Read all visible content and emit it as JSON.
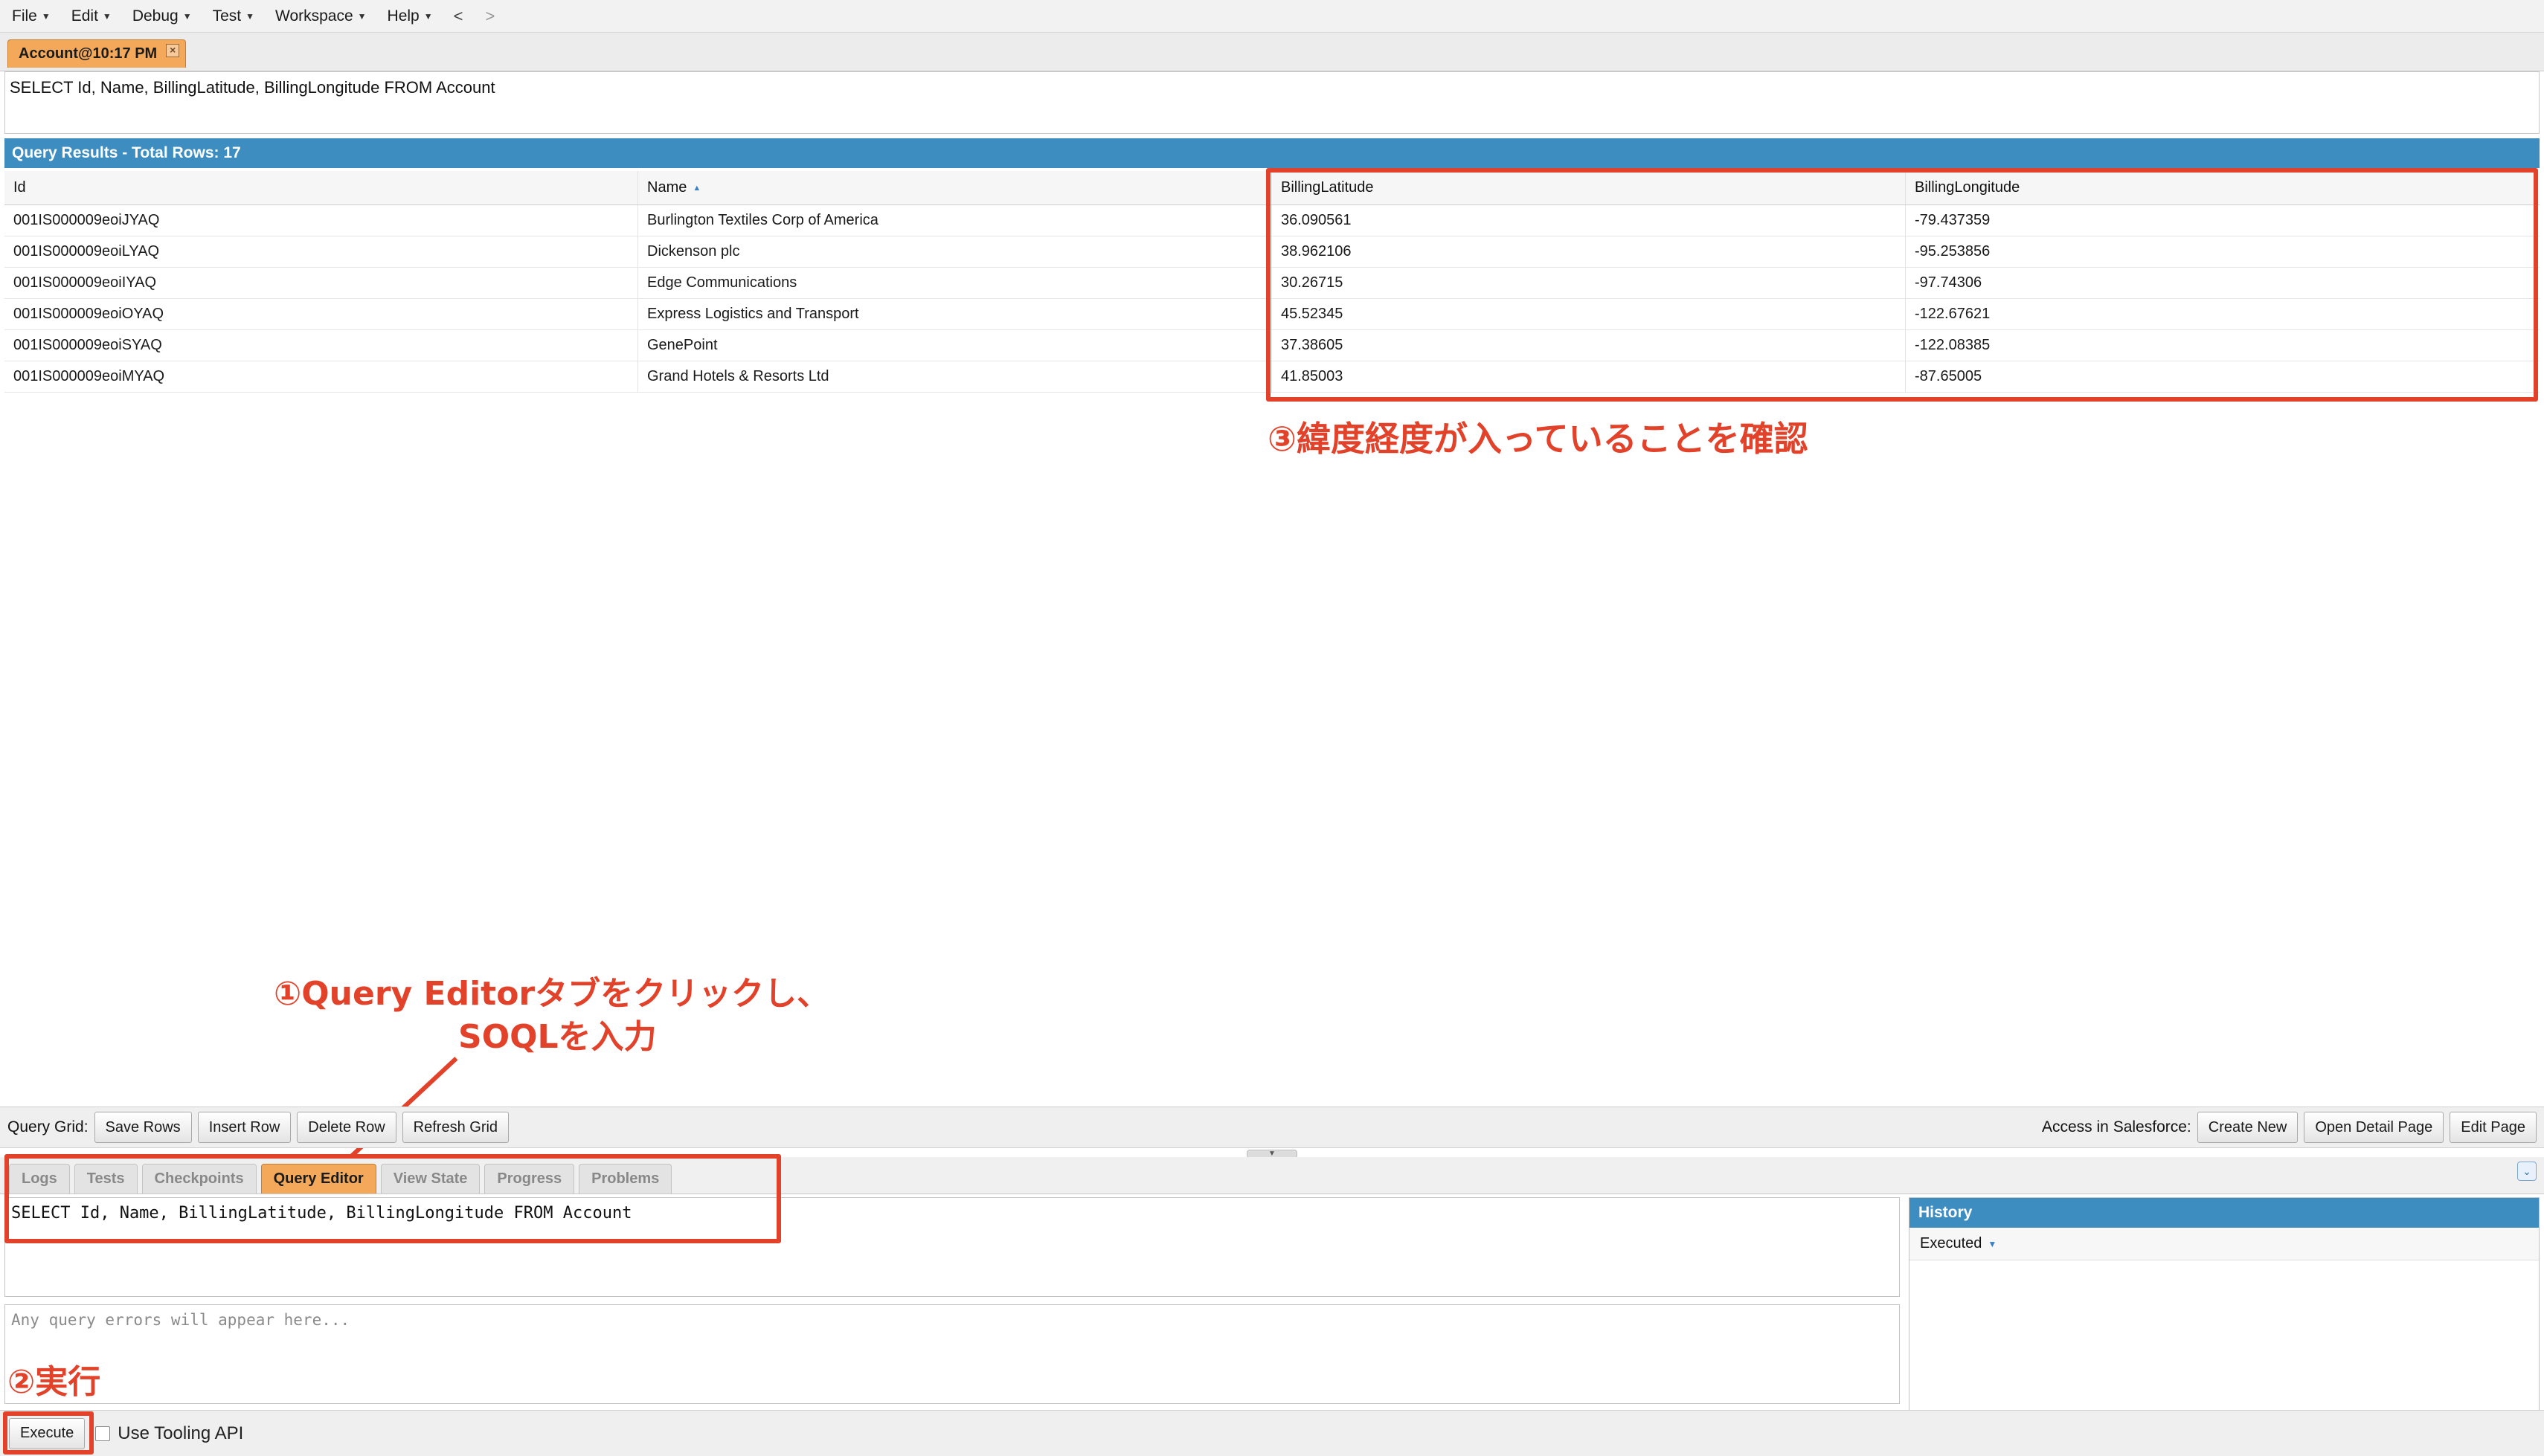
{
  "menu": {
    "items": [
      "File",
      "Edit",
      "Debug",
      "Test",
      "Workspace",
      "Help"
    ],
    "back": "<",
    "forward": ">"
  },
  "file_tab": {
    "label": "Account@10:17 PM",
    "close": "×"
  },
  "query_display": "SELECT Id, Name, BillingLatitude, BillingLongitude FROM Account",
  "results": {
    "header": "Query Results - Total Rows: 17",
    "columns": [
      "Id",
      "Name",
      "BillingLatitude",
      "BillingLongitude"
    ],
    "sorted_column": "Name",
    "rows": [
      [
        "001IS000009eoiJYAQ",
        "Burlington Textiles Corp of America",
        "36.090561",
        "-79.437359"
      ],
      [
        "001IS000009eoiLYAQ",
        "Dickenson plc",
        "38.962106",
        "-95.253856"
      ],
      [
        "001IS000009eoiIYAQ",
        "Edge Communications",
        "30.26715",
        "-97.74306"
      ],
      [
        "001IS000009eoiOYAQ",
        "Express Logistics and Transport",
        "45.52345",
        "-122.67621"
      ],
      [
        "001IS000009eoiSYAQ",
        "GenePoint",
        "37.38605",
        "-122.08385"
      ],
      [
        "001IS000009eoiMYAQ",
        "Grand Hotels & Resorts Ltd",
        "41.85003",
        "-87.65005"
      ]
    ]
  },
  "annotations": {
    "step3": "③緯度経度が入っていることを確認",
    "step1_line1": "①Query Editorタブをクリックし、",
    "step1_line2": "SOQLを入力",
    "step2": "②実行",
    "color": "#e2412a"
  },
  "grid_toolbar": {
    "label": "Query Grid:",
    "buttons": [
      "Save Rows",
      "Insert Row",
      "Delete Row",
      "Refresh Grid"
    ],
    "right_label": "Access in Salesforce:",
    "right_buttons": [
      "Create New",
      "Open Detail Page",
      "Edit Page"
    ]
  },
  "lower_tabs": {
    "tabs": [
      "Logs",
      "Tests",
      "Checkpoints",
      "Query Editor",
      "View State",
      "Progress",
      "Problems"
    ],
    "active": "Query Editor"
  },
  "editor": {
    "query": "SELECT Id, Name, BillingLatitude, BillingLongitude FROM Account",
    "errors_placeholder": "Any query errors will appear here..."
  },
  "history": {
    "title": "History",
    "column": "Executed"
  },
  "bottom": {
    "execute_label": "Execute",
    "tooling_label": "Use Tooling API"
  },
  "colors": {
    "accent_blue": "#3d8dc0",
    "active_tab": "#f4a95a"
  }
}
